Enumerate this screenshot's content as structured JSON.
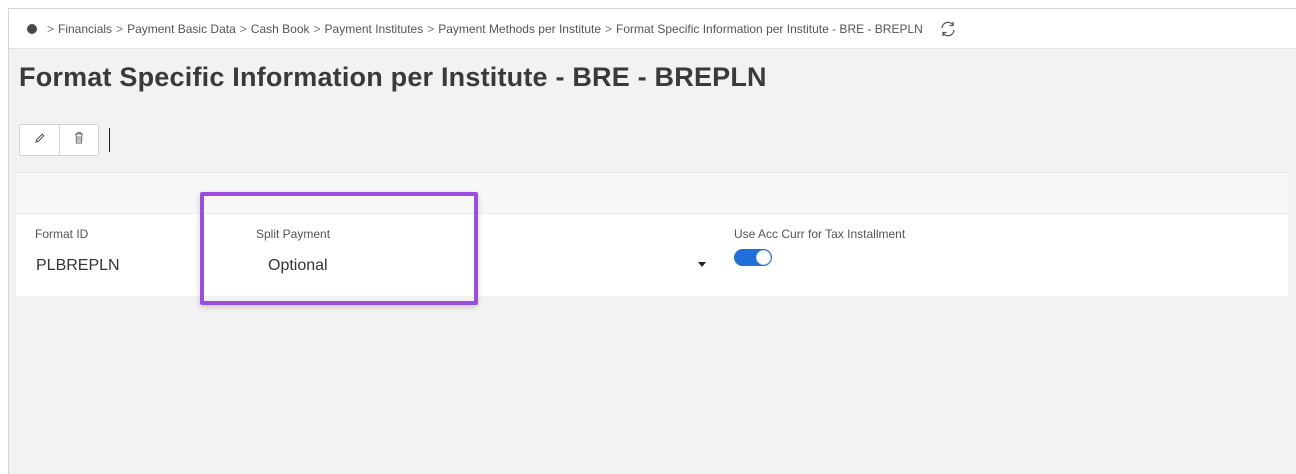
{
  "breadcrumb": {
    "items": [
      "Financials",
      "Payment Basic Data",
      "Cash Book",
      "Payment Institutes",
      "Payment Methods per Institute",
      "Format Specific Information per Institute - BRE - BREPLN"
    ],
    "separator": ">"
  },
  "page": {
    "title": "Format Specific Information per Institute - BRE - BREPLN"
  },
  "toolbar": {
    "edit_icon": "pencil-icon",
    "delete_icon": "trash-icon"
  },
  "form": {
    "format_id": {
      "label": "Format ID",
      "value": "PLBREPLN"
    },
    "split_payment": {
      "label": "Split Payment",
      "value": "Optional"
    },
    "use_acc_curr": {
      "label": "Use Acc Curr for Tax Installment",
      "checked": true
    }
  },
  "colors": {
    "highlight": "#9a4ee0",
    "toggle_on": "#1f6fd6"
  }
}
